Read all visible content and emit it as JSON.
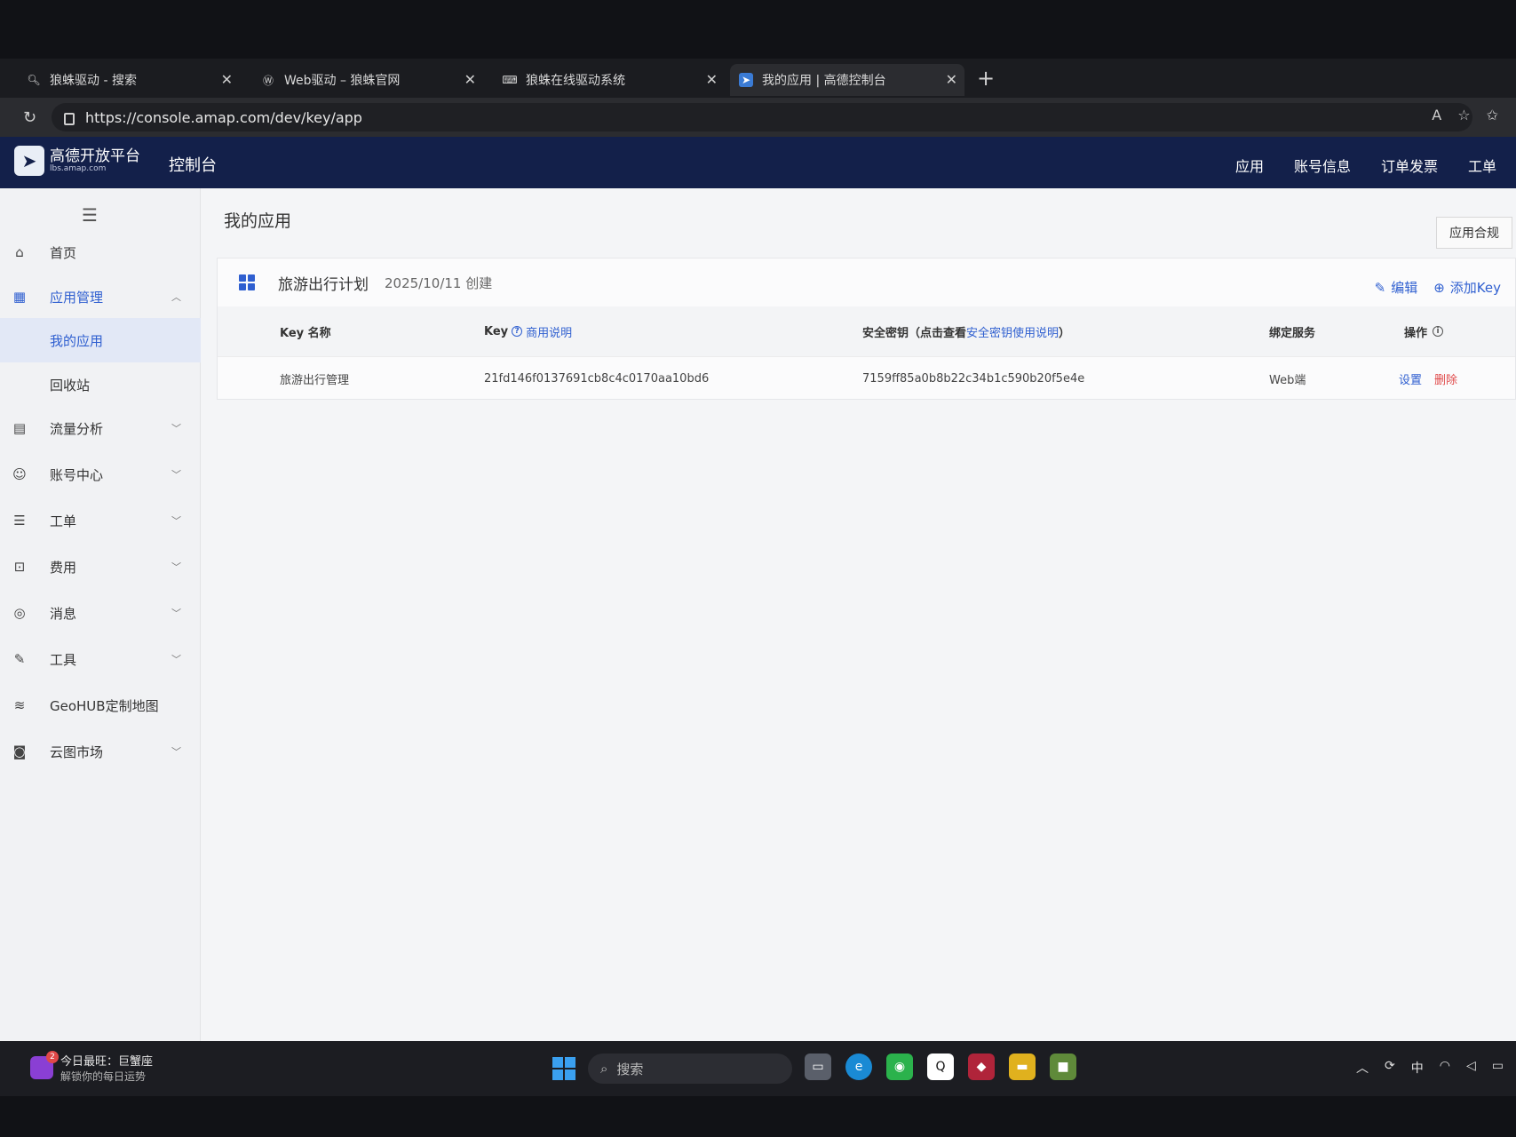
{
  "browser": {
    "tabs": [
      {
        "label": "狼蛛驱动 - 搜索",
        "icon": "search-icon"
      },
      {
        "label": "Web驱动 – 狼蛛官网",
        "icon": "wordpress-icon"
      },
      {
        "label": "狼蛛在线驱动系统",
        "icon": "keyboard-icon"
      },
      {
        "label": "我的应用 | 高德控制台",
        "icon": "amap-icon",
        "active": true
      }
    ],
    "url": "https://console.amap.com/dev/key/app"
  },
  "topnav": {
    "brand": "高德开放平台",
    "brand_sub": "lbs.amap.com",
    "console": "控制台",
    "links": [
      "应用",
      "账号信息",
      "订单发票",
      "工单"
    ]
  },
  "sidebar": {
    "items": [
      {
        "label": "首页",
        "icon": "home-icon"
      },
      {
        "label": "应用管理",
        "icon": "grid-icon",
        "open": true
      },
      {
        "label": "我的应用",
        "sub": true,
        "selected": true
      },
      {
        "label": "回收站",
        "sub": true
      },
      {
        "label": "流量分析",
        "icon": "chart-icon"
      },
      {
        "label": "账号中心",
        "icon": "user-icon"
      },
      {
        "label": "工单",
        "icon": "ticket-icon"
      },
      {
        "label": "费用",
        "icon": "billing-icon"
      },
      {
        "label": "消息",
        "icon": "message-icon"
      },
      {
        "label": "工具",
        "icon": "wrench-icon"
      },
      {
        "label": "GeoHUB定制地图",
        "icon": "layers-icon"
      },
      {
        "label": "云图市场",
        "icon": "cloud-icon"
      }
    ]
  },
  "main": {
    "title": "我的应用",
    "compliance_button": "应用合规",
    "app": {
      "name": "旅游出行计划",
      "created": "2025/10/11 创建",
      "edit_label": "编辑",
      "add_key_label": "添加Key",
      "columns": {
        "key_name": "Key 名称",
        "key": "Key",
        "key_note": "商用说明",
        "secret_prefix": "安全密钥（点击查看",
        "secret_link": "安全密钥使用说明",
        "secret_suffix": "）",
        "service": "绑定服务",
        "actions": "操作"
      },
      "rows": [
        {
          "key_name": "旅游出行管理",
          "key": "21fd146f0137691cb8c4c0170aa10bd6",
          "secret": "7159ff85a0b8b22c34b1c590b20f5e4e",
          "service": "Web端",
          "setting": "设置",
          "delete": "删除"
        }
      ]
    }
  },
  "taskbar": {
    "widget_title": "今日最旺：巨蟹座",
    "widget_sub": "解锁你的每日运势",
    "widget_badge": "2",
    "search_placeholder": "搜索",
    "ime": "中"
  }
}
